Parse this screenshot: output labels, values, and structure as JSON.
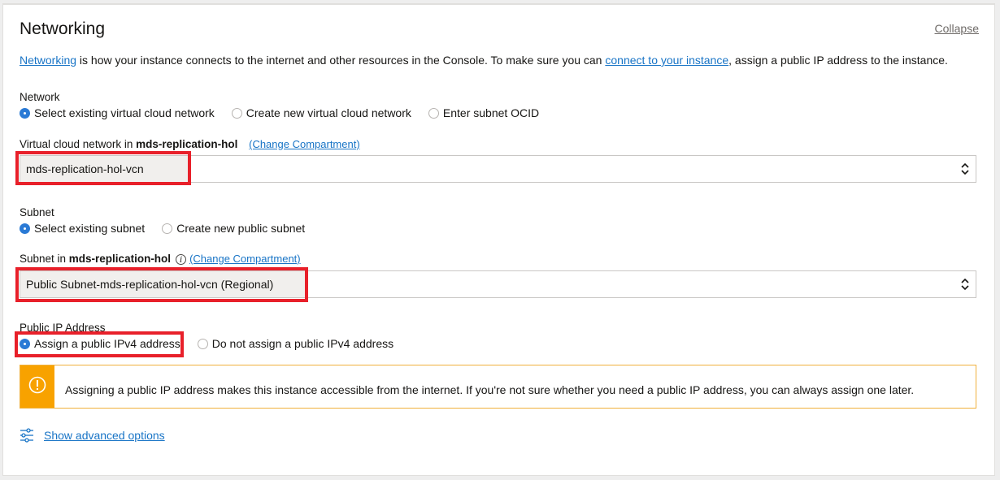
{
  "section": {
    "title": "Networking",
    "collapse_label": "Collapse"
  },
  "intro": {
    "link1": "Networking",
    "text1": " is how your instance connects to the internet and other resources in the Console. To make sure you can ",
    "link2": "connect to your instance",
    "text2": ", assign a public IP address to the instance."
  },
  "network": {
    "label": "Network",
    "options": [
      {
        "label": "Select existing virtual cloud network",
        "selected": true
      },
      {
        "label": "Create new virtual cloud network",
        "selected": false
      },
      {
        "label": "Enter subnet OCID",
        "selected": false
      }
    ]
  },
  "vcn": {
    "label_prefix": "Virtual cloud network in ",
    "compartment": "mds-replication-hol",
    "change_link": "(Change Compartment)",
    "value": "mds-replication-hol-vcn"
  },
  "subnet": {
    "label": "Subnet",
    "options": [
      {
        "label": "Select existing subnet",
        "selected": true
      },
      {
        "label": "Create new public subnet",
        "selected": false
      }
    ]
  },
  "subnet_select": {
    "label_prefix": "Subnet in ",
    "compartment": "mds-replication-hol",
    "change_link": "(Change Compartment)",
    "value": "Public Subnet-mds-replication-hol-vcn (Regional)"
  },
  "public_ip": {
    "label": "Public IP Address",
    "options": [
      {
        "label": "Assign a public IPv4 address",
        "selected": true
      },
      {
        "label": "Do not assign a public IPv4 address",
        "selected": false
      }
    ]
  },
  "warning": {
    "icon": "exclamation-circle-icon",
    "message": "Assigning a public IP address makes this instance accessible from the internet. If you're not sure whether you need a public IP address, you can always assign one later."
  },
  "advanced": {
    "icon": "sliders-icon",
    "label": "Show advanced options"
  },
  "colors": {
    "link": "#1874c6",
    "radio_selected": "#2a7ad5",
    "warning": "#f8a200",
    "highlight": "#e8202a"
  }
}
